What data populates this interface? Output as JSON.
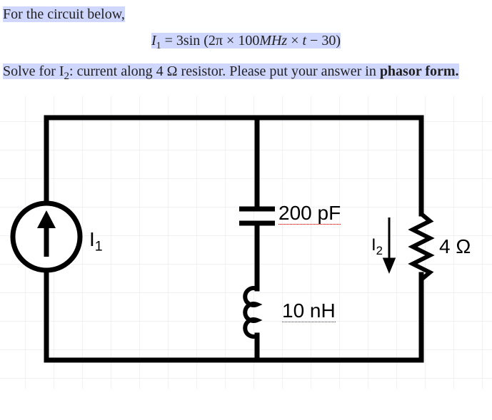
{
  "problem": {
    "intro": "For the circuit below,",
    "equation_lhs": "I",
    "equation_sub": "1",
    "equation_eq": " = 3sin (2π × 100",
    "equation_unit1": "MHz",
    "equation_mid": " × ",
    "equation_var": "t",
    "equation_tail": " − 30)",
    "solve_pre": "Solve for I",
    "solve_sub": "2",
    "solve_mid": ": current along 4 Ω resistor. Please put your answer in ",
    "solve_bold": "phasor form.",
    "solve_period": ""
  },
  "circuit": {
    "source_label": "I",
    "source_sub": "1",
    "cap_value": "200 pF",
    "ind_value": "10 nH",
    "res_value": "4 Ω",
    "current_label": "I",
    "current_sub": "2"
  }
}
